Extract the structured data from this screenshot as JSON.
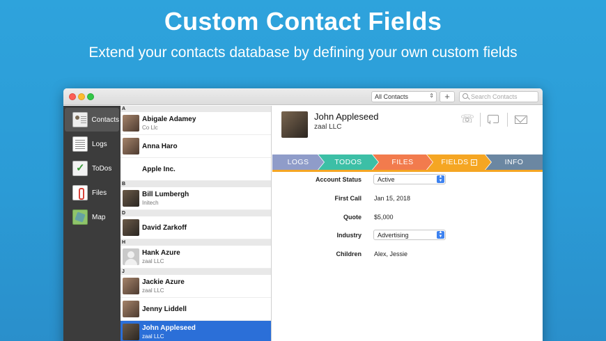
{
  "hero": {
    "title": "Custom Contact Fields",
    "subtitle": "Extend your contacts database by defining your own custom fields"
  },
  "toolbar": {
    "filter_value": "All Contacts",
    "add_label": "+",
    "search_placeholder": "Search Contacts"
  },
  "sidebar": {
    "items": [
      {
        "label": "Contacts",
        "icon": "contacts-icon"
      },
      {
        "label": "Logs",
        "icon": "logs-icon"
      },
      {
        "label": "ToDos",
        "icon": "todos-icon"
      },
      {
        "label": "Files",
        "icon": "files-icon"
      },
      {
        "label": "Map",
        "icon": "map-icon"
      }
    ]
  },
  "list": {
    "sections": [
      "A",
      "B",
      "D",
      "H",
      "J"
    ],
    "rows": [
      {
        "name": "Abigale Adamey",
        "sub": "Co Llc"
      },
      {
        "name": "Anna Haro",
        "sub": ""
      },
      {
        "name": "Apple Inc.",
        "sub": ""
      },
      {
        "name": "Bill Lumbergh",
        "sub": "Initech"
      },
      {
        "name": "David Zarkoff",
        "sub": ""
      },
      {
        "name": "Hank Azure",
        "sub": "zaal LLC"
      },
      {
        "name": "Jackie Azure",
        "sub": "zaal LLC"
      },
      {
        "name": "Jenny Liddell",
        "sub": ""
      },
      {
        "name": "John Appleseed",
        "sub": "zaal LLC"
      }
    ]
  },
  "detail": {
    "name": "John Appleseed",
    "company": "zaal LLC",
    "tabs": [
      "LOGS",
      "TODOS",
      "FILES",
      "FIELDS",
      "INFO"
    ],
    "active_tab": "FIELDS",
    "fields": {
      "account_status_label": "Account Status",
      "account_status_value": "Active",
      "first_call_label": "First Call",
      "first_call_value": "Jan 15, 2018",
      "quote_label": "Quote",
      "quote_value": "$5,000",
      "industry_label": "Industry",
      "industry_value": "Advertising",
      "children_label": "Children",
      "children_value": "Alex, Jessie"
    }
  },
  "colors": {
    "background": "#2ea3dc",
    "selection": "#2b6fd8",
    "tab_logs": "#8f9cc9",
    "tab_todos": "#3cbfa6",
    "tab_files": "#f27b4d",
    "tab_fields": "#f5a623",
    "tab_info": "#6b87a2"
  }
}
